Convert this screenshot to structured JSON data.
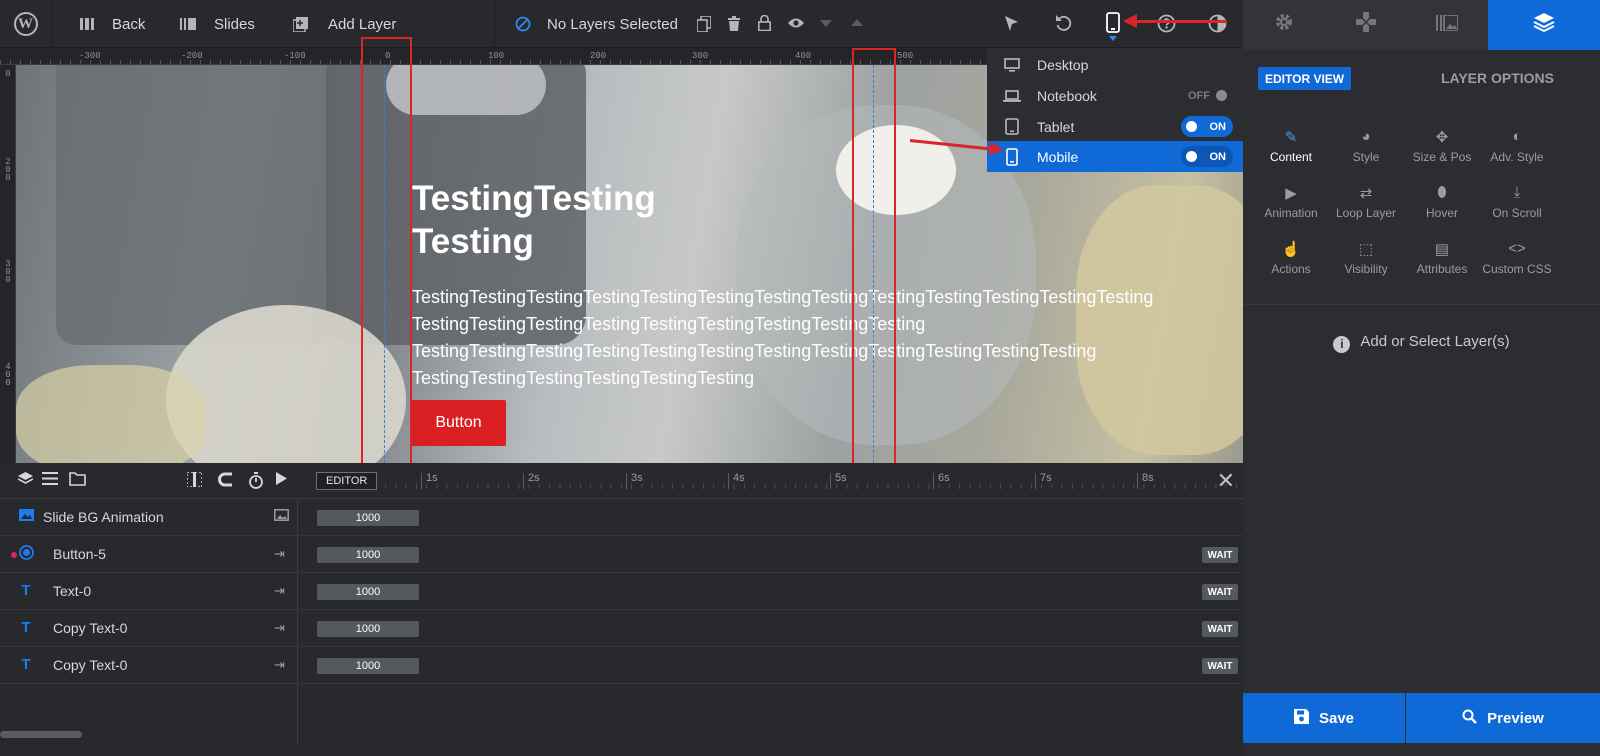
{
  "toolbar": {
    "back_label": "Back",
    "slides_label": "Slides",
    "add_layer_label": "Add Layer",
    "selection_status": "No Layers Selected"
  },
  "ruler": {
    "top_ticks": [
      "-300",
      "-200",
      "-100",
      "0",
      "100",
      "200",
      "300",
      "400",
      "500"
    ],
    "left_ticks": [
      "0",
      "200",
      "300",
      "400"
    ]
  },
  "canvas": {
    "title": "TestingTesting\nTesting",
    "paragraph": [
      "TestingTestingTestingTestingTestingTestingTestingTestingTestingTestingTestingTestingTesting",
      "TestingTestingTestingTestingTestingTestingTestingTestingTesting",
      "TestingTestingTestingTestingTestingTestingTestingTestingTestingTestingTestingTesting",
      "TestingTestingTestingTestingTestingTesting"
    ],
    "button_label": "Button"
  },
  "device_menu": {
    "items": [
      {
        "label": "Desktop",
        "icon": "monitor-icon",
        "toggle": null
      },
      {
        "label": "Notebook",
        "icon": "laptop-icon",
        "toggle": "OFF"
      },
      {
        "label": "Tablet",
        "icon": "tablet-icon",
        "toggle": "ON"
      },
      {
        "label": "Mobile",
        "icon": "mobile-icon",
        "toggle": "ON",
        "active": true
      }
    ]
  },
  "sidebar": {
    "editor_view": "EDITOR VIEW",
    "layer_options": "LAYER OPTIONS",
    "options": [
      {
        "label": "Content",
        "icon": "pencil-icon"
      },
      {
        "label": "Style",
        "icon": "palette-icon"
      },
      {
        "label": "Size & Pos",
        "icon": "move-icon"
      },
      {
        "label": "Adv. Style",
        "icon": "contrast-icon"
      },
      {
        "label": "Animation",
        "icon": "play-icon"
      },
      {
        "label": "Loop Layer",
        "icon": "loop-icon"
      },
      {
        "label": "Hover",
        "icon": "mouse-icon"
      },
      {
        "label": "On Scroll",
        "icon": "scroll-icon"
      },
      {
        "label": "Actions",
        "icon": "pointer-icon"
      },
      {
        "label": "Visibility",
        "icon": "visibility-icon"
      },
      {
        "label": "Attributes",
        "icon": "document-icon"
      },
      {
        "label": "Custom CSS",
        "icon": "code-icon"
      }
    ],
    "add_select": "Add or Select Layer(s)",
    "save_label": "Save",
    "preview_label": "Preview"
  },
  "timeline": {
    "editor_tag": "EDITOR",
    "seconds": [
      "1s",
      "2s",
      "3s",
      "4s",
      "5s",
      "6s",
      "7s",
      "8s"
    ],
    "layers": [
      {
        "name": "Slide BG Animation",
        "icon": "image-icon",
        "duration": "1000",
        "wait": null
      },
      {
        "name": "Button-5",
        "icon": "button-icon",
        "duration": "1000",
        "wait": "WAIT",
        "marked": true
      },
      {
        "name": "Text-0",
        "icon": "text-icon",
        "duration": "1000",
        "wait": "WAIT"
      },
      {
        "name": "Copy Text-0",
        "icon": "text-icon",
        "duration": "1000",
        "wait": "WAIT"
      },
      {
        "name": "Copy Text-0",
        "icon": "text-icon",
        "duration": "1000",
        "wait": "WAIT"
      }
    ]
  },
  "colors": {
    "accent": "#0f69d7",
    "annotation_red": "#d8262a",
    "canvas_button": "#da1f24",
    "marker_pink": "#e0237a"
  }
}
